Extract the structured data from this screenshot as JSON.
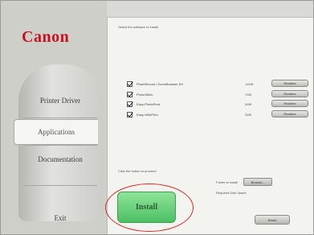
{
  "brand": {
    "logo_text": "Canon",
    "logo_color": "#c8101e"
  },
  "nav": {
    "items": [
      {
        "label": "Printer Driver",
        "active": false
      },
      {
        "label": "Applications",
        "active": true
      },
      {
        "label": "Documentation",
        "active": false
      },
      {
        "label": "Exit",
        "active": false
      }
    ]
  },
  "main": {
    "instruction": "Select the software to install",
    "software": [
      {
        "label": "PhotoRecord / ZoomBrowser EX",
        "size": "14MB",
        "readme": "Readme"
      },
      {
        "label": "PhotoStitch",
        "size": "7MB",
        "readme": "Readme"
      },
      {
        "label": "Easy-PhotoPrint",
        "size": "9MB",
        "readme": "Readme"
      },
      {
        "label": "Easy-WebPrint",
        "size": "3MB",
        "readme": "Readme"
      }
    ],
    "select_text": "Click the button to proceed",
    "folder_label": "Folder to install",
    "browse_label": "Browse...",
    "disk_label": "Required Disk Space",
    "install_label": "Install",
    "reset_label": "Reset"
  },
  "colors": {
    "install_green": "#5ccc70",
    "highlight_red": "#d92a2a"
  }
}
